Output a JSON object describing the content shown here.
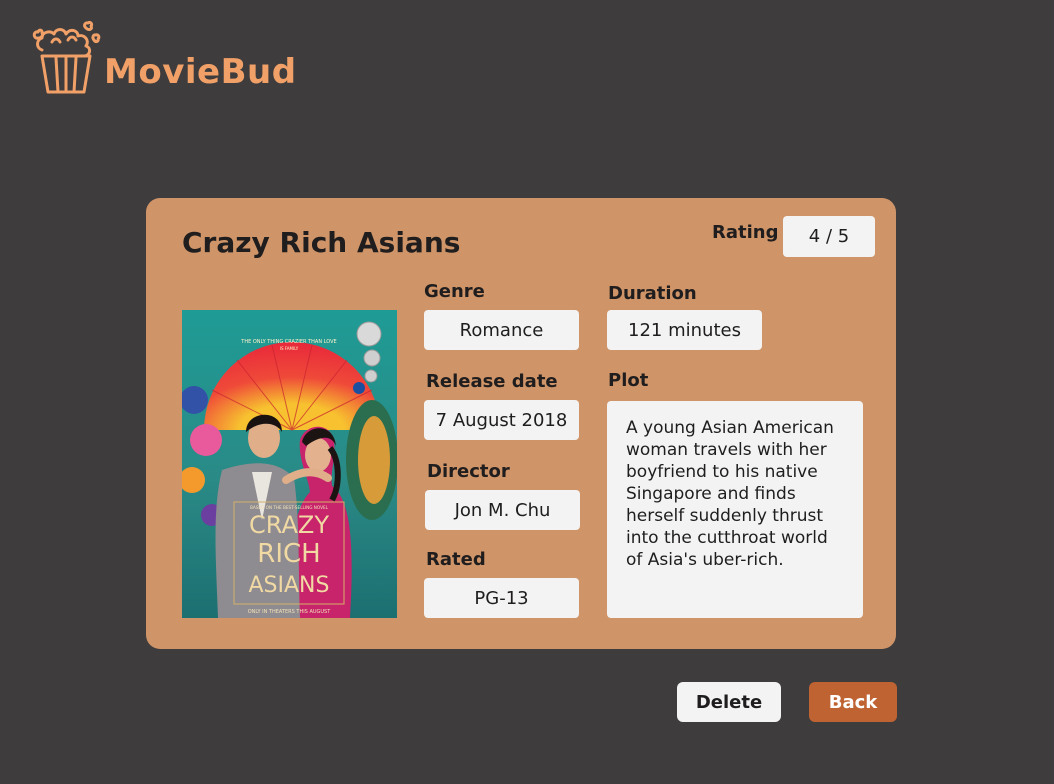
{
  "brand": {
    "name": "MovieBud",
    "logo_icon": "popcorn-icon",
    "accent_color": "#f1a068"
  },
  "movie": {
    "title": "Crazy Rich Asians",
    "rating_label": "Rating",
    "rating_value": "4 / 5",
    "genre_label": "Genre",
    "genre": "Romance",
    "duration_label": "Duration",
    "duration": "121 minutes",
    "release_label": "Release date",
    "release_date": "7 August 2018",
    "plot_label": "Plot",
    "plot": "A young Asian American woman travels with her boyfriend to his native Singapore and finds herself suddenly thrust into the cutthroat world of Asia's uber-rich.",
    "director_label": "Director",
    "director": "Jon M. Chu",
    "rated_label": "Rated",
    "rated": "PG-13"
  },
  "poster": {
    "tagline": "THE ONLY THING CRAZIER THAN LOVE",
    "tagline2": "IS FAMILY",
    "novel_note": "BASED ON THE BEST-SELLING NOVEL",
    "title_line1": "CRAZY",
    "title_line2": "RICH",
    "title_line3": "ASIANS",
    "release_note": "ONLY IN THEATERS THIS AUGUST"
  },
  "actions": {
    "delete_label": "Delete",
    "back_label": "Back"
  },
  "colors": {
    "background": "#3e3c3d",
    "card": "#cf9467",
    "field": "#f3f3f3",
    "back_button": "#bf6332"
  }
}
